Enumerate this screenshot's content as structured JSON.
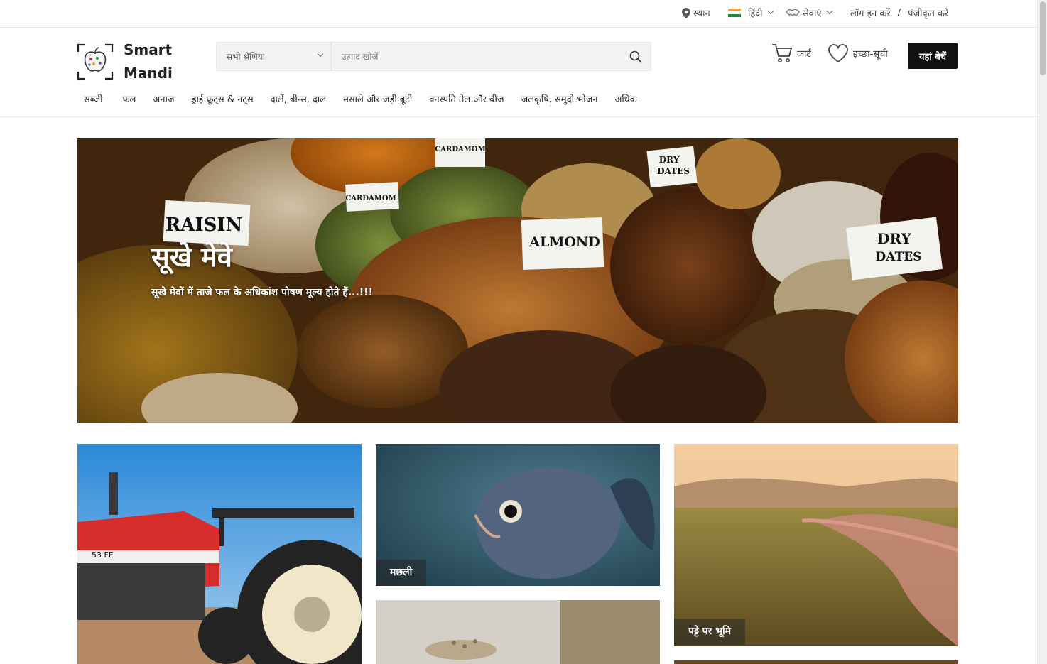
{
  "topbar": {
    "location": "स्थान",
    "language": "हिंदी",
    "services": "सेवाएं",
    "login": "लॉग इन करें",
    "separator": "/",
    "register": "पंजीकृत करें"
  },
  "brand": {
    "line1": "Smart",
    "line2": "Mandi"
  },
  "search": {
    "category": "सभी श्रेणियां",
    "placeholder": "उत्पाद खोजें"
  },
  "header": {
    "cart": "कार्ट",
    "wishlist": "इच्छा-सूची",
    "sell": "यहां बेचें"
  },
  "nav": {
    "items": [
      "सब्जी",
      "फल",
      "अनाज",
      "ड्राई फ्रूट्स & नट्स",
      "दालें, बीन्स, दाल",
      "मसाले और जड़ी बूटी",
      "वनस्पति तेल और बीज",
      "जलकृषि, समुद्री भोजन",
      "अधिक"
    ]
  },
  "hero": {
    "title": "सूखे मेवे",
    "subtitle": "सूखे मेवों में ताजे फल के अधिकांश पोषण मूल्य होते हैं...!!!",
    "signs": [
      "Raisin",
      "Cardamom",
      "Cardamom",
      "Almond",
      "Dry dates",
      "Dry dates"
    ]
  },
  "tiles": {
    "fish": "मछली",
    "land": "पट्टे पर भूमि"
  },
  "colors": {
    "accent": "#111111",
    "hero_bg": "#5a3412"
  }
}
